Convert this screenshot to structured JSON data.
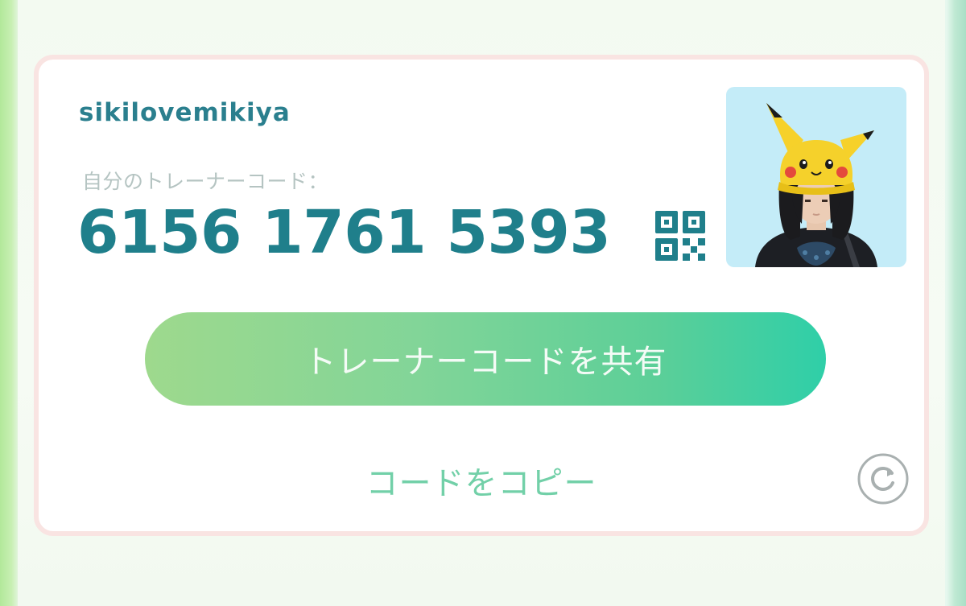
{
  "trainer": {
    "username": "sikilovemikiya",
    "code_label": "自分のトレーナーコード：",
    "code": "6156 1761 5393"
  },
  "actions": {
    "share_label": "トレーナーコードを共有",
    "copy_label": "コードをコピー"
  },
  "icons": {
    "qr": "qr-code-icon",
    "refresh": "refresh-icon",
    "avatar": "trainer-avatar"
  },
  "colors": {
    "accent_teal": "#1f7f8b",
    "label_gray": "#b5c4c2",
    "share_gradient_start": "#9ed98d",
    "share_gradient_end": "#2fcfa8",
    "copy_text": "#72d0a8",
    "avatar_bg": "#c4ecf8",
    "card_border": "#f9e4e2"
  }
}
